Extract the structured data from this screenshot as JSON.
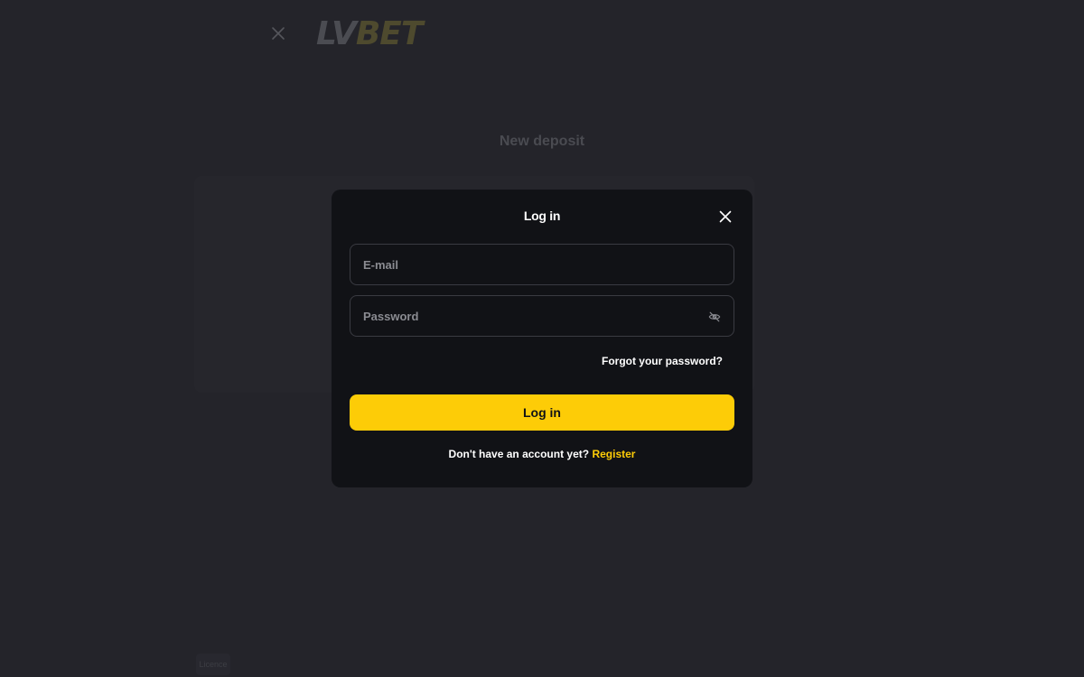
{
  "background": {
    "logo": {
      "part1": "LV",
      "part2": "BET"
    },
    "page_title": "New deposit",
    "chip_label": "Licence"
  },
  "modal": {
    "title": "Log in",
    "email": {
      "placeholder": "E-mail",
      "value": ""
    },
    "password": {
      "placeholder": "Password",
      "value": ""
    },
    "forgot_password": "Forgot your password?",
    "login_button": "Log in",
    "register_prompt": "Don't have an account yet?",
    "register_link": "Register"
  },
  "colors": {
    "accent": "#fdcc07",
    "modal_bg": "#111216",
    "page_bg": "#24242a",
    "field_border": "#3a3b42"
  },
  "icons": {
    "background_close": "close-icon",
    "modal_close": "close-icon",
    "password_toggle": "eye-off-icon"
  }
}
